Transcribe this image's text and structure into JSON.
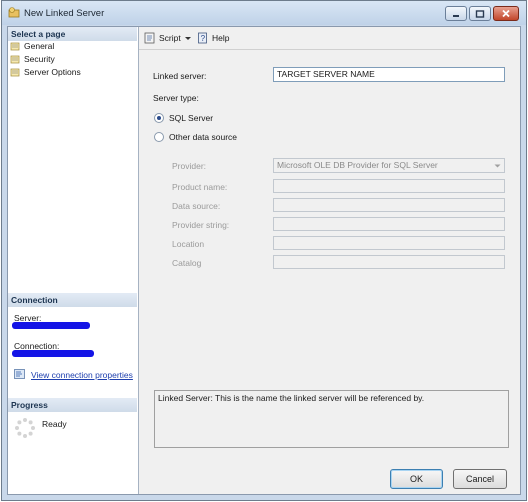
{
  "window": {
    "title": "New Linked Server"
  },
  "left_pane": {
    "select_page_header": "Select a page",
    "pages": [
      {
        "label": "General"
      },
      {
        "label": "Security"
      },
      {
        "label": "Server Options"
      }
    ],
    "connection_header": "Connection",
    "server_label": "Server:",
    "connection_label": "Connection:",
    "view_connection_link": "View connection properties",
    "progress_header": "Progress",
    "progress_status": "Ready"
  },
  "toolbar": {
    "script_label": "Script",
    "help_label": "Help"
  },
  "form": {
    "linked_server_label": "Linked server:",
    "linked_server_value": "TARGET SERVER NAME",
    "server_type_label": "Server type:",
    "sql_server_option": "SQL Server",
    "other_source_option": "Other data source",
    "sql_server_selected": true,
    "provider_label": "Provider:",
    "provider_value": "Microsoft OLE DB Provider for SQL Server",
    "product_name_label": "Product name:",
    "data_source_label": "Data source:",
    "provider_string_label": "Provider string:",
    "location_label": "Location",
    "catalog_label": "Catalog"
  },
  "description": "Linked Server: This is the name the linked server will be referenced by.",
  "buttons": {
    "ok": "OK",
    "cancel": "Cancel"
  }
}
